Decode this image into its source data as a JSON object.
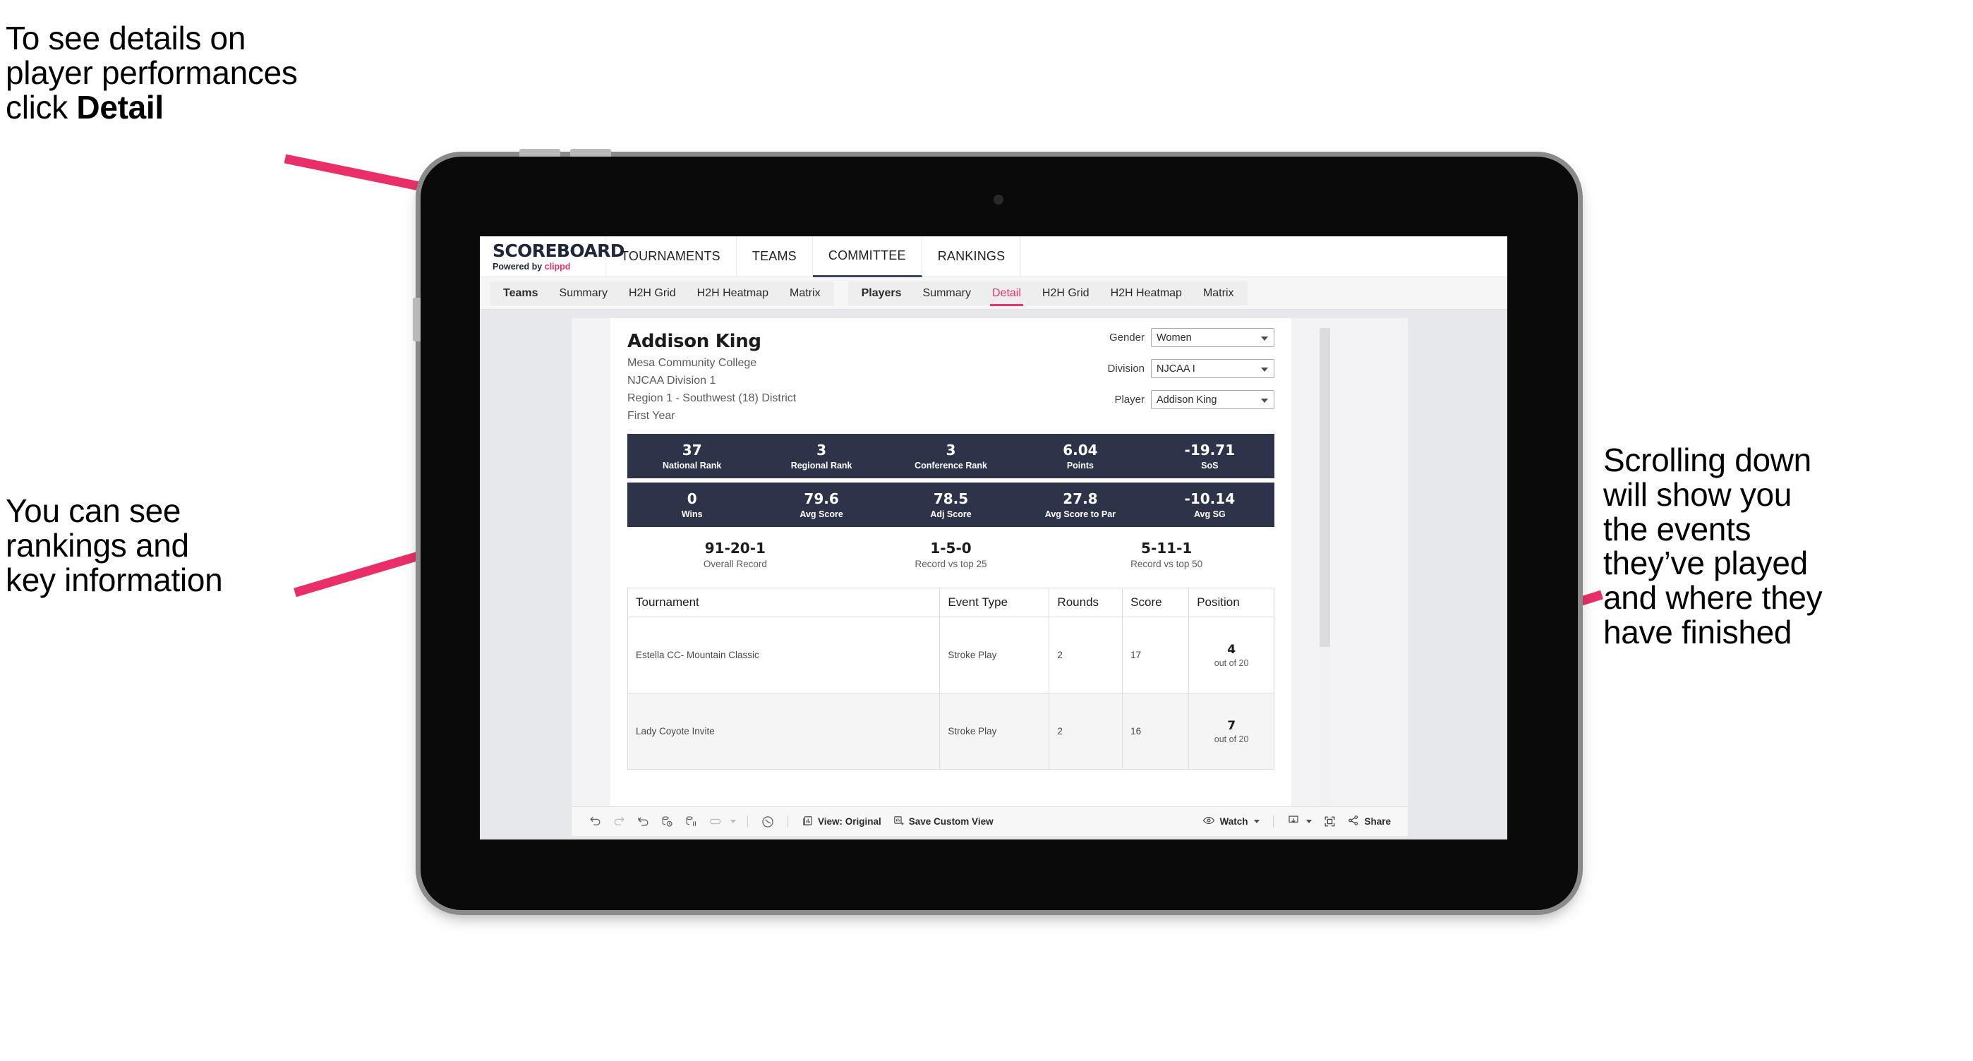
{
  "annotations": {
    "detail_note": "To see details on\nplayer performances\nclick ",
    "detail_note_bold": "Detail",
    "ranking_note": "You can see\nrankings and\nkey information",
    "scroll_note": "Scrolling down\nwill show you\nthe events\nthey’ve played\nand where they\nhave finished",
    "arrow_color": "#ea2f68"
  },
  "app": {
    "logo_word": "SCOREBOARD",
    "logo_sub_prefix": "Powered by ",
    "logo_brand": "clippd",
    "topnav": [
      {
        "label": "TOURNAMENTS"
      },
      {
        "label": "TEAMS"
      },
      {
        "label": "COMMITTEE"
      },
      {
        "label": "RANKINGS"
      }
    ],
    "subnav": {
      "group_teams": [
        {
          "label": "Teams",
          "bold": true
        },
        {
          "label": "Summary"
        },
        {
          "label": "H2H Grid"
        },
        {
          "label": "H2H Heatmap"
        },
        {
          "label": "Matrix"
        }
      ],
      "group_players": [
        {
          "label": "Players",
          "bold": true
        },
        {
          "label": "Summary"
        },
        {
          "label": "Detail",
          "selected": true
        },
        {
          "label": "H2H Grid"
        },
        {
          "label": "H2H Heatmap"
        },
        {
          "label": "Matrix"
        }
      ]
    }
  },
  "player": {
    "name": "Addison King",
    "school": "Mesa Community College",
    "division": "NJCAA Division 1",
    "region": "Region 1 - Southwest (18) District",
    "year": "First Year"
  },
  "filters": [
    {
      "label": "Gender",
      "value": "Women"
    },
    {
      "label": "Division",
      "value": "NJCAA I"
    },
    {
      "label": "Player",
      "value": "Addison King"
    }
  ],
  "stats_band_1": [
    {
      "value": "37",
      "label": "National Rank"
    },
    {
      "value": "3",
      "label": "Regional Rank"
    },
    {
      "value": "3",
      "label": "Conference Rank"
    },
    {
      "value": "6.04",
      "label": "Points"
    },
    {
      "value": "-19.71",
      "label": "SoS"
    }
  ],
  "stats_band_2": [
    {
      "value": "0",
      "label": "Wins"
    },
    {
      "value": "79.6",
      "label": "Avg Score"
    },
    {
      "value": "78.5",
      "label": "Adj Score"
    },
    {
      "value": "27.8",
      "label": "Avg Score to Par"
    },
    {
      "value": "-10.14",
      "label": "Avg SG"
    }
  ],
  "records": [
    {
      "value": "91-20-1",
      "label": "Overall Record"
    },
    {
      "value": "1-5-0",
      "label": "Record vs top 25"
    },
    {
      "value": "5-11-1",
      "label": "Record vs top 50"
    }
  ],
  "events_table": {
    "columns": [
      "Tournament",
      "Event Type",
      "Rounds",
      "Score",
      "Position"
    ],
    "rows": [
      {
        "tournament": "Estella CC- Mountain Classic",
        "event_type": "Stroke Play",
        "rounds": "2",
        "score": "17",
        "position": "4",
        "position_of": "out of 20"
      },
      {
        "tournament": "Lady Coyote Invite",
        "event_type": "Stroke Play",
        "rounds": "2",
        "score": "16",
        "position": "7",
        "position_of": "out of 20"
      }
    ]
  },
  "toolbar": {
    "view_label": "View: Original",
    "save_label": "Save Custom View",
    "watch_label": "Watch",
    "share_label": "Share"
  },
  "colors": {
    "band": "#2d3449",
    "accent": "#e8336d",
    "canvas": "#e7e8ec"
  }
}
